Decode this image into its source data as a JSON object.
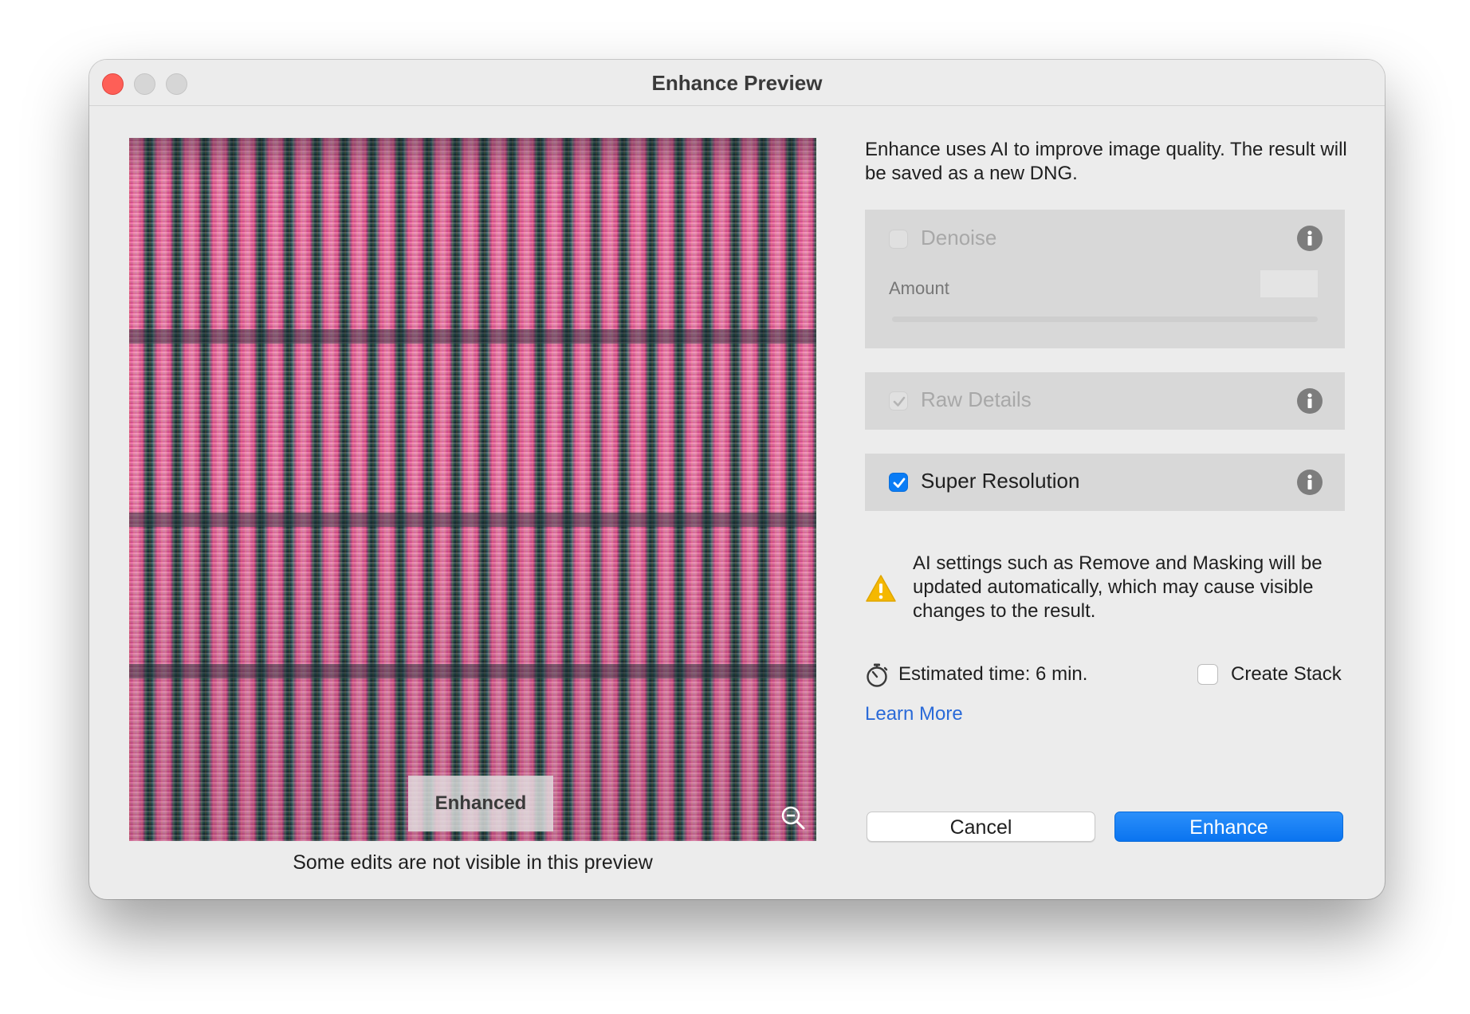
{
  "window": {
    "title": "Enhance Preview"
  },
  "preview": {
    "tag": "Enhanced",
    "caption": "Some edits are not visible in this preview",
    "zoom_icon": "zoom-out-icon"
  },
  "description": "Enhance uses AI to improve image quality. The result will be saved as a new DNG.",
  "options": {
    "denoise": {
      "label": "Denoise",
      "checked": false,
      "enabled": false,
      "amount_label": "Amount",
      "amount_value": ""
    },
    "raw_details": {
      "label": "Raw Details",
      "checked": true,
      "enabled": false
    },
    "super_resolution": {
      "label": "Super Resolution",
      "checked": true,
      "enabled": true
    }
  },
  "warning": {
    "text": "AI settings such as Remove and Masking will be updated automatically, which may cause visible changes to the result.",
    "icon": "warning-icon"
  },
  "estimate": {
    "text": "Estimated time: 6 min.",
    "icon": "stopwatch-icon"
  },
  "create_stack": {
    "label": "Create Stack",
    "checked": false
  },
  "learn_more": "Learn More",
  "buttons": {
    "cancel": "Cancel",
    "enhance": "Enhance"
  },
  "colors": {
    "accent": "#0a7cf5",
    "link": "#2a6ad8",
    "close_button": "#fe5f57",
    "warning": "#f5b800"
  }
}
